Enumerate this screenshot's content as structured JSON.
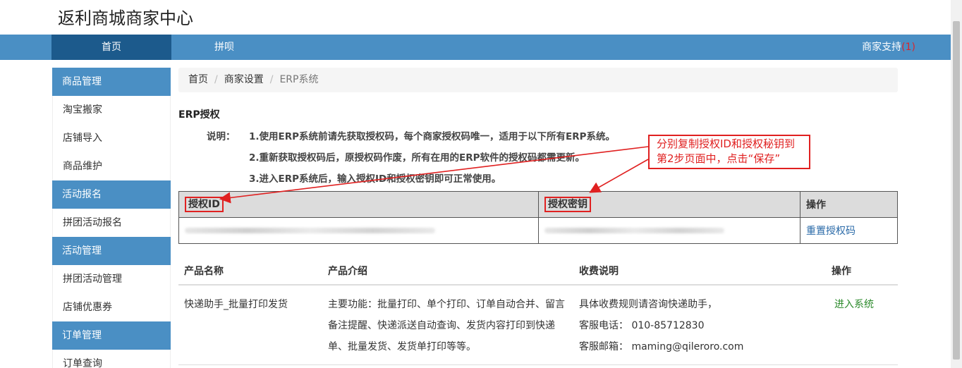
{
  "site_title": "返利商城商家中心",
  "topnav": {
    "home": "首页",
    "pintuan": "拼呗",
    "support_label": "商家支持",
    "support_count": "(1)"
  },
  "sidebar": [
    {
      "head": "商品管理",
      "links": [
        "淘宝搬家",
        "店铺导入",
        "商品维护"
      ]
    },
    {
      "head": "活动报名",
      "links": [
        "拼团活动报名"
      ]
    },
    {
      "head": "活动管理",
      "links": [
        "拼团活动管理",
        "店铺优惠券"
      ]
    },
    {
      "head": "订单管理",
      "links": [
        "订单查询"
      ]
    }
  ],
  "breadcrumb": [
    "首页",
    "商家设置",
    "ERP系统"
  ],
  "section_title": "ERP授权",
  "notes": {
    "label": "说明：",
    "lines": [
      "1.使用ERP系统前请先获取授权码，每个商家授权码唯一，适用于以下所有ERP系统。",
      "2.重新获取授权码后，原授权码作废，所有在用的ERP软件的授权码都需更新。",
      "3.进入ERP系统后，输入授权ID和授权密钥即可正常使用。"
    ]
  },
  "auth_table": {
    "headers": {
      "id": "授权ID",
      "secret": "授权密钥",
      "op": "操作"
    },
    "reset_label": "重置授权码"
  },
  "product_table": {
    "headers": {
      "name": "产品名称",
      "intro": "产品介绍",
      "fee": "收费说明",
      "op": "操作"
    },
    "rows": [
      {
        "name": "快递助手_批量打印发货",
        "intro": "主要功能：批量打印、单个打印、订单自动合并、留言备注提醒、快递派送自动查询、发货内容打印到快递单、批量发货、发货单打印等等。",
        "fee_lines": [
          "具体收费规则请咨询快递助手，",
          "客服电话： 010-85712830",
          "客服邮箱： maming@qileroro.com"
        ],
        "op": "进入系统"
      }
    ]
  },
  "annotation": {
    "line1": "分别复制授权ID和授权秘钥到",
    "line2": "第2步页面中，点击“保存”"
  },
  "colors": {
    "nav_blue": "#4a8fc4",
    "nav_active": "#1c5a8c",
    "annotation_red": "#e02020",
    "link_green": "#2c8a2c",
    "link_blue": "#2a6aa8"
  }
}
